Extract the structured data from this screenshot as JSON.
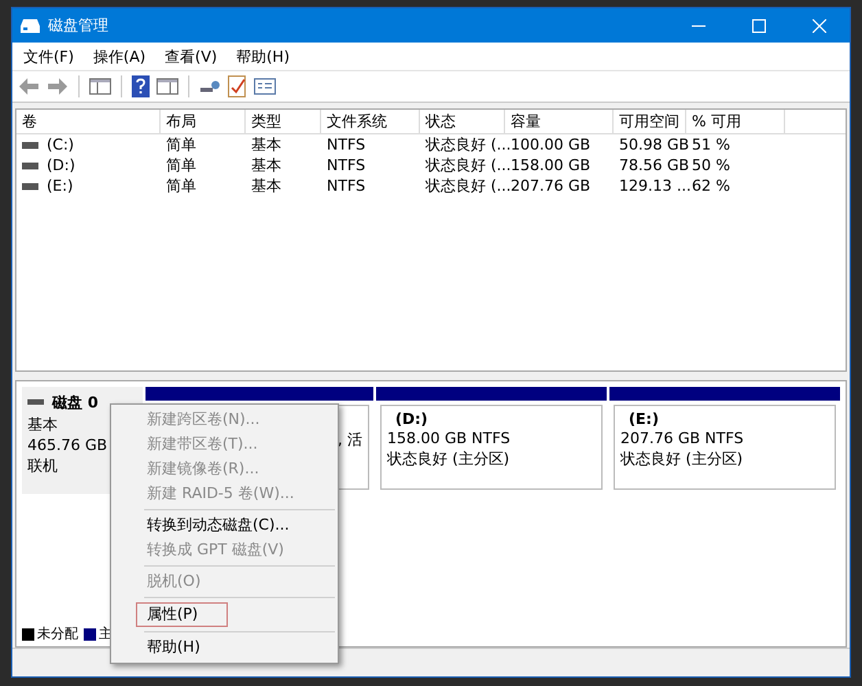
{
  "window": {
    "title": "磁盘管理"
  },
  "menu": [
    "文件(F)",
    "操作(A)",
    "查看(V)",
    "帮助(H)"
  ],
  "table": {
    "columns": [
      "卷",
      "布局",
      "类型",
      "文件系统",
      "状态",
      "容量",
      "可用空间",
      "% 可用"
    ],
    "rows": [
      [
        "(C:)",
        "简单",
        "基本",
        "NTFS",
        "状态良好 (...",
        "100.00 GB",
        "50.98 GB",
        "51 %"
      ],
      [
        "(D:)",
        "简单",
        "基本",
        "NTFS",
        "状态良好 (...",
        "158.00 GB",
        "78.56 GB",
        "50 %"
      ],
      [
        "(E:)",
        "简单",
        "基本",
        "NTFS",
        "状态良好 (...",
        "207.76 GB",
        "129.13 ...",
        "62 %"
      ]
    ]
  },
  "disk": {
    "name": "磁盘 0",
    "type": "基本",
    "size": "465.76 GB",
    "status": "联机",
    "partitions": [
      {
        "lines": [
          ", 活"
        ]
      },
      {
        "name": "(D:)",
        "lines": [
          "158.00 GB NTFS",
          "状态良好 (主分区)"
        ]
      },
      {
        "name": "(E:)",
        "lines": [
          "207.76 GB NTFS",
          "状态良好 (主分区)"
        ]
      }
    ]
  },
  "legend": [
    {
      "label": "未分配",
      "color": "#000000"
    },
    {
      "label": "主",
      "color": "#000080"
    }
  ],
  "context_menu": [
    {
      "kind": "item",
      "label": "新建跨区卷(N)...",
      "disabled": true,
      "highlighted": false
    },
    {
      "kind": "item",
      "label": "新建带区卷(T)...",
      "disabled": true,
      "highlighted": false
    },
    {
      "kind": "item",
      "label": "新建镜像卷(R)...",
      "disabled": true,
      "highlighted": false
    },
    {
      "kind": "item",
      "label": "新建 RAID-5 卷(W)...",
      "disabled": true,
      "highlighted": false
    },
    {
      "kind": "separator"
    },
    {
      "kind": "item",
      "label": "转换到动态磁盘(C)...",
      "disabled": false,
      "highlighted": false
    },
    {
      "kind": "item",
      "label": "转换成 GPT 磁盘(V)",
      "disabled": true,
      "highlighted": false
    },
    {
      "kind": "separator"
    },
    {
      "kind": "item",
      "label": "脱机(O)",
      "disabled": true,
      "highlighted": false
    },
    {
      "kind": "separator"
    },
    {
      "kind": "item",
      "label": "属性(P)",
      "disabled": false,
      "highlighted": true
    },
    {
      "kind": "separator"
    },
    {
      "kind": "item",
      "label": "帮助(H)",
      "disabled": false,
      "highlighted": false
    }
  ]
}
